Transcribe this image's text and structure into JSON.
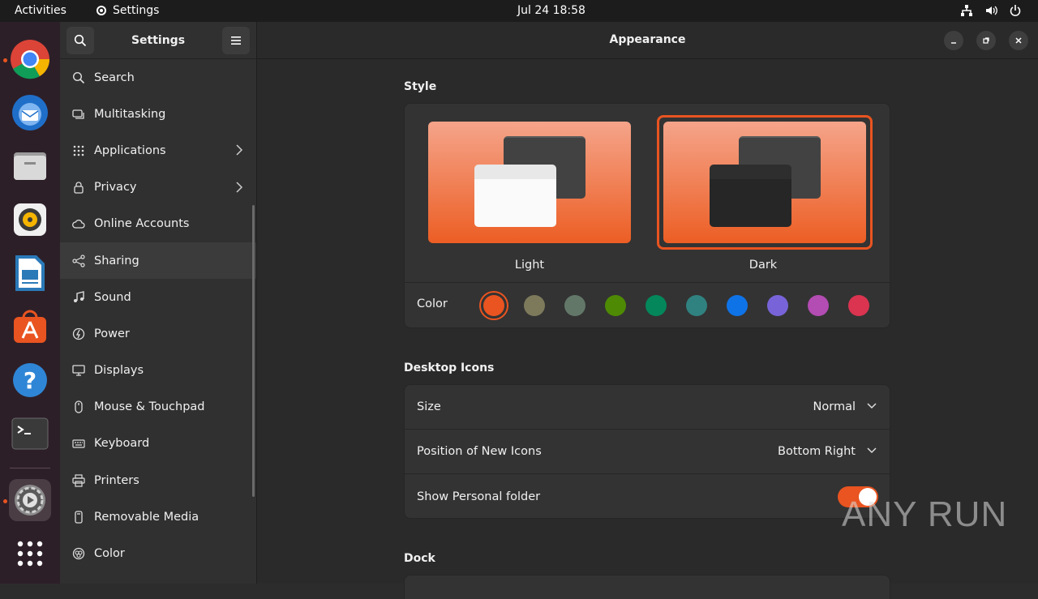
{
  "topbar": {
    "activities": "Activities",
    "app_name": "Settings",
    "clock": "Jul 24  18:58"
  },
  "sidebar": {
    "title": "Settings",
    "items": [
      {
        "label": "Search",
        "icon": "search-icon"
      },
      {
        "label": "Multitasking",
        "icon": "multitasking-icon"
      },
      {
        "label": "Applications",
        "icon": "applications-icon",
        "chevron": true
      },
      {
        "label": "Privacy",
        "icon": "lock-icon",
        "chevron": true
      },
      {
        "label": "Online Accounts",
        "icon": "cloud-icon"
      },
      {
        "label": "Sharing",
        "icon": "share-icon",
        "selected": true
      },
      {
        "label": "Sound",
        "icon": "music-note-icon"
      },
      {
        "label": "Power",
        "icon": "power-icon"
      },
      {
        "label": "Displays",
        "icon": "display-icon"
      },
      {
        "label": "Mouse & Touchpad",
        "icon": "mouse-icon"
      },
      {
        "label": "Keyboard",
        "icon": "keyboard-icon"
      },
      {
        "label": "Printers",
        "icon": "printer-icon"
      },
      {
        "label": "Removable Media",
        "icon": "removable-media-icon"
      },
      {
        "label": "Color",
        "icon": "color-icon"
      }
    ]
  },
  "main": {
    "title": "Appearance",
    "style": {
      "section_title": "Style",
      "light_label": "Light",
      "dark_label": "Dark",
      "selected": "Dark",
      "color_label": "Color",
      "colors": [
        "#e95420",
        "#7d7a5c",
        "#627768",
        "#4e8a04",
        "#03875b",
        "#308280",
        "#0f73e8",
        "#7864d8",
        "#b34cb3",
        "#da3450"
      ],
      "selected_color": "#e95420"
    },
    "desktop_icons": {
      "section_title": "Desktop Icons",
      "size_label": "Size",
      "size_value": "Normal",
      "position_label": "Position of New Icons",
      "position_value": "Bottom Right",
      "personal_folder_label": "Show Personal folder",
      "personal_folder_on": true
    },
    "dock": {
      "section_title": "Dock"
    }
  },
  "watermark": "ANY RUN",
  "accent_color": "#e95420"
}
